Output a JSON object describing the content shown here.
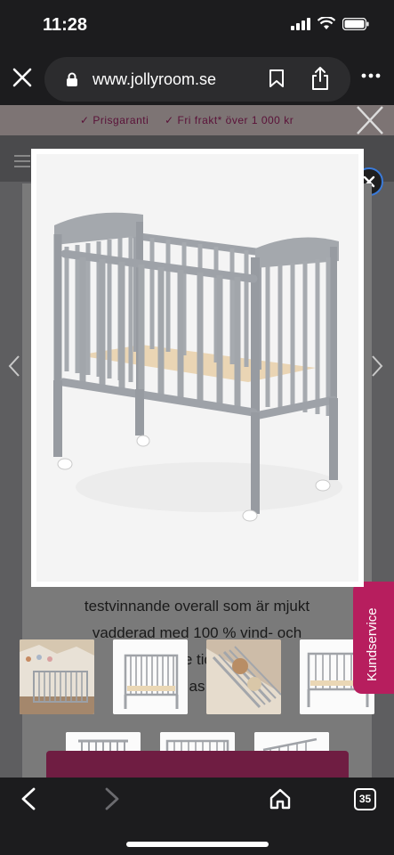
{
  "status_bar": {
    "time": "11:28"
  },
  "browser": {
    "url": "www.jollyroom.se"
  },
  "promo": {
    "item1": "✓ Prisgaranti",
    "item2": "✓ Fri frakt* över 1 000 kr"
  },
  "description": {
    "line1": "testvinnande overall som är mjukt",
    "line2": "vadderad med 100 % vind- och",
    "line3": "vatte      tid       ter",
    "line4": "as"
  },
  "kundservice": {
    "label": "Kundservice"
  },
  "tab_count": "35",
  "icons": [
    "close-icon",
    "lock-icon",
    "bookmark-icon",
    "share-icon",
    "more-icon",
    "back-icon",
    "forward-icon",
    "home-icon",
    "tabs-icon"
  ]
}
